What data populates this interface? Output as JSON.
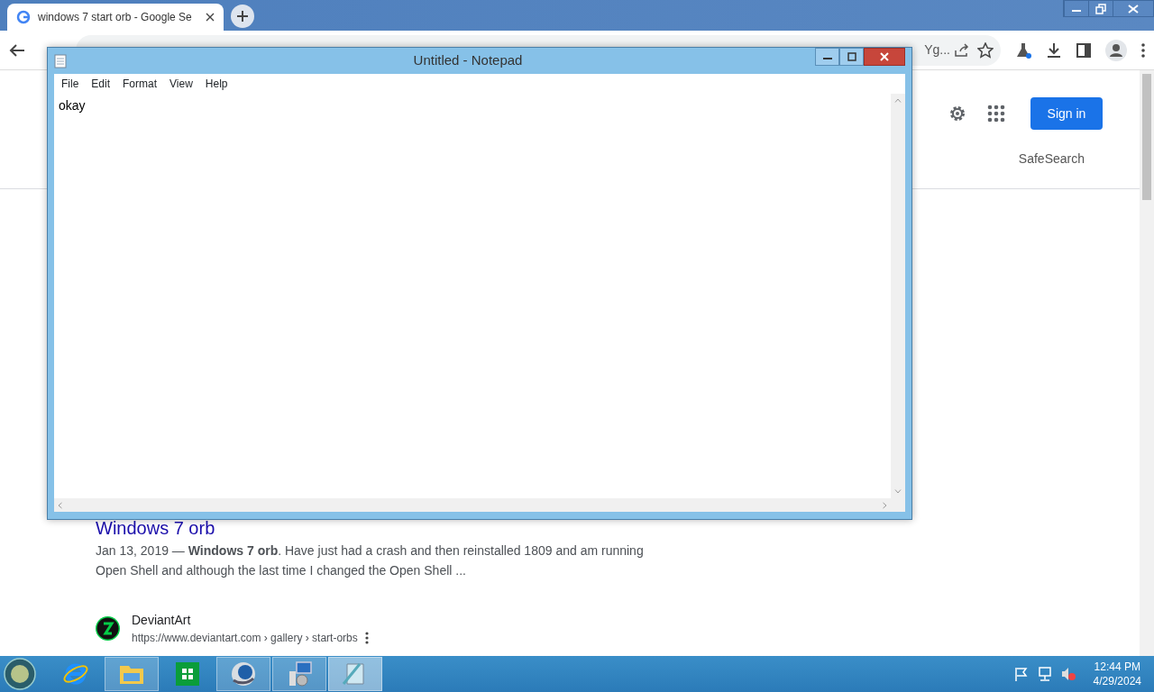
{
  "browser": {
    "tabs": [
      {
        "title": "windows 7 start orb - Google Se",
        "selected": true
      }
    ],
    "address_fragment": "Yg...",
    "header": {
      "sign_in": "Sign in",
      "safesearch": "SafeSearch"
    },
    "results": [
      {
        "kind": "title",
        "title": "Windows 7 orb",
        "snippet": "Jan 13, 2019 — **Windows 7 orb**. Have just had a crash and then reinstalled 1809 and am running Open Shell and although the last time I changed the Open Shell ..."
      },
      {
        "kind": "site",
        "site": "DeviantArt",
        "url": "https://www.deviantart.com › gallery › start-orbs"
      }
    ]
  },
  "notepad": {
    "title": "Untitled - Notepad",
    "menu": [
      "File",
      "Edit",
      "Format",
      "View",
      "Help"
    ],
    "text": "okay"
  },
  "taskbar": {
    "items": [
      {
        "kind": "ie",
        "running": false,
        "active": false
      },
      {
        "kind": "explorer",
        "running": true,
        "active": false
      },
      {
        "kind": "store",
        "running": false,
        "active": false
      },
      {
        "kind": "browser",
        "running": true,
        "active": false
      },
      {
        "kind": "installer",
        "running": true,
        "active": false
      },
      {
        "kind": "notepad",
        "running": true,
        "active": true
      }
    ],
    "time": "12:44 PM",
    "date": "4/29/2024"
  }
}
